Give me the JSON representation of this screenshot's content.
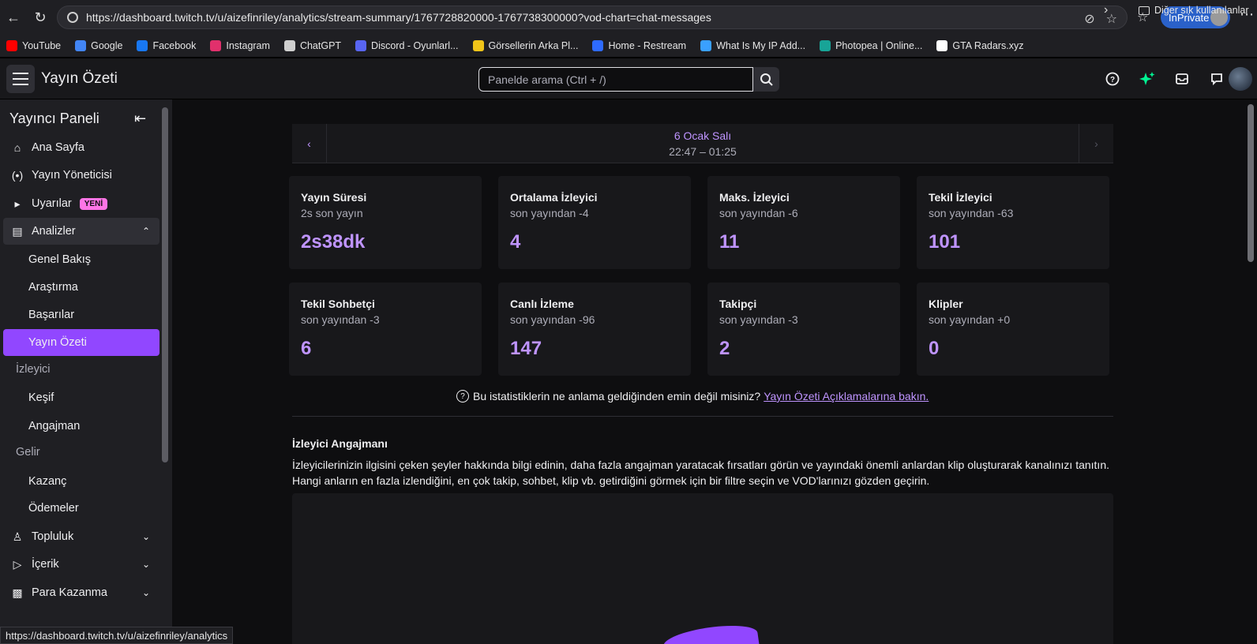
{
  "browser": {
    "url": "https://dashboard.twitch.tv/u/aizefinriley/analytics/stream-summary/1767728820000-1767738300000?vod-chart=chat-messages",
    "inprivate_label": "InPrivate",
    "status_url": "https://dashboard.twitch.tv/u/aizefinriley/analytics"
  },
  "bookmarks": [
    {
      "label": "YouTube",
      "icon": "youtube-icon",
      "color": "#ff0000"
    },
    {
      "label": "Google",
      "icon": "google-icon",
      "color": "#4285f4"
    },
    {
      "label": "Facebook",
      "icon": "facebook-icon",
      "color": "#1877f2"
    },
    {
      "label": "Instagram",
      "icon": "instagram-icon",
      "color": "#e1306c"
    },
    {
      "label": "ChatGPT",
      "icon": "chatgpt-icon",
      "color": "#cfcfcf"
    },
    {
      "label": "Discord - Oyunlarl...",
      "icon": "discord-icon",
      "color": "#5865f2"
    },
    {
      "label": "Görsellerin Arka Pl...",
      "icon": "image-icon",
      "color": "#f0c419"
    },
    {
      "label": "Home - Restream",
      "icon": "restream-icon",
      "color": "#2e6bff"
    },
    {
      "label": "What Is My IP Add...",
      "icon": "globe-icon",
      "color": "#3aa0ff"
    },
    {
      "label": "Photopea | Online...",
      "icon": "photopea-icon",
      "color": "#18a497"
    },
    {
      "label": "GTA Radars.xyz",
      "icon": "gta-icon",
      "color": "#ffffff"
    }
  ],
  "bookmarks_other": "Diğer sık kullanılanlar",
  "header": {
    "title": "Yayın Özeti",
    "search_placeholder": "Panelde arama (Ctrl + /)"
  },
  "sidebar": {
    "title": "Yayıncı Paneli",
    "items": [
      {
        "label": "Ana Sayfa"
      },
      {
        "label": "Yayın Yöneticisi"
      },
      {
        "label": "Uyarılar",
        "badge": "YENİ"
      },
      {
        "label": "Analizler"
      },
      {
        "label": "Genel Bakış"
      },
      {
        "label": "Araştırma"
      },
      {
        "label": "Başarılar"
      },
      {
        "label": "Yayın Özeti"
      },
      {
        "label": "İzleyici"
      },
      {
        "label": "Keşif"
      },
      {
        "label": "Angajman"
      },
      {
        "label": "Gelir"
      },
      {
        "label": "Kazanç"
      },
      {
        "label": "Ödemeler"
      },
      {
        "label": "Topluluk"
      },
      {
        "label": "İçerik"
      },
      {
        "label": "Para Kazanma"
      }
    ]
  },
  "summary": {
    "date": "6 Ocak Salı",
    "time": "22:47 – 01:25",
    "cards": [
      {
        "title": "Yayın Süresi",
        "sub": "2s son yayın",
        "value": "2s38dk"
      },
      {
        "title": "Ortalama İzleyici",
        "sub": "son yayından -4",
        "value": "4"
      },
      {
        "title": "Maks. İzleyici",
        "sub": "son yayından -6",
        "value": "11"
      },
      {
        "title": "Tekil İzleyici",
        "sub": "son yayından -63",
        "value": "101"
      },
      {
        "title": "Tekil Sohbetçi",
        "sub": "son yayından -3",
        "value": "6"
      },
      {
        "title": "Canlı İzleme",
        "sub": "son yayından -96",
        "value": "147"
      },
      {
        "title": "Takipçi",
        "sub": "son yayından -3",
        "value": "2"
      },
      {
        "title": "Klipler",
        "sub": "son yayından +0",
        "value": "0"
      }
    ],
    "help_text": "Bu istatistiklerin ne anlama geldiğinden emin değil misiniz?",
    "help_link": "Yayın Özeti Açıklamalarına bakın."
  },
  "engagement": {
    "title": "İzleyici Angajmanı",
    "description": "İzleyicilerinizin ilgisini çeken şeyler hakkında bilgi edinin, daha fazla angajman yaratacak fırsatları görün ve yayındaki önemli anlardan klip oluşturarak kanalınızı tanıtın. Hangi anların en fazla izlendiğini, en çok takip, sohbet, klip vb. getirdiğini görmek için bir filtre seçin ve VOD'larınızı gözden geçirin."
  }
}
